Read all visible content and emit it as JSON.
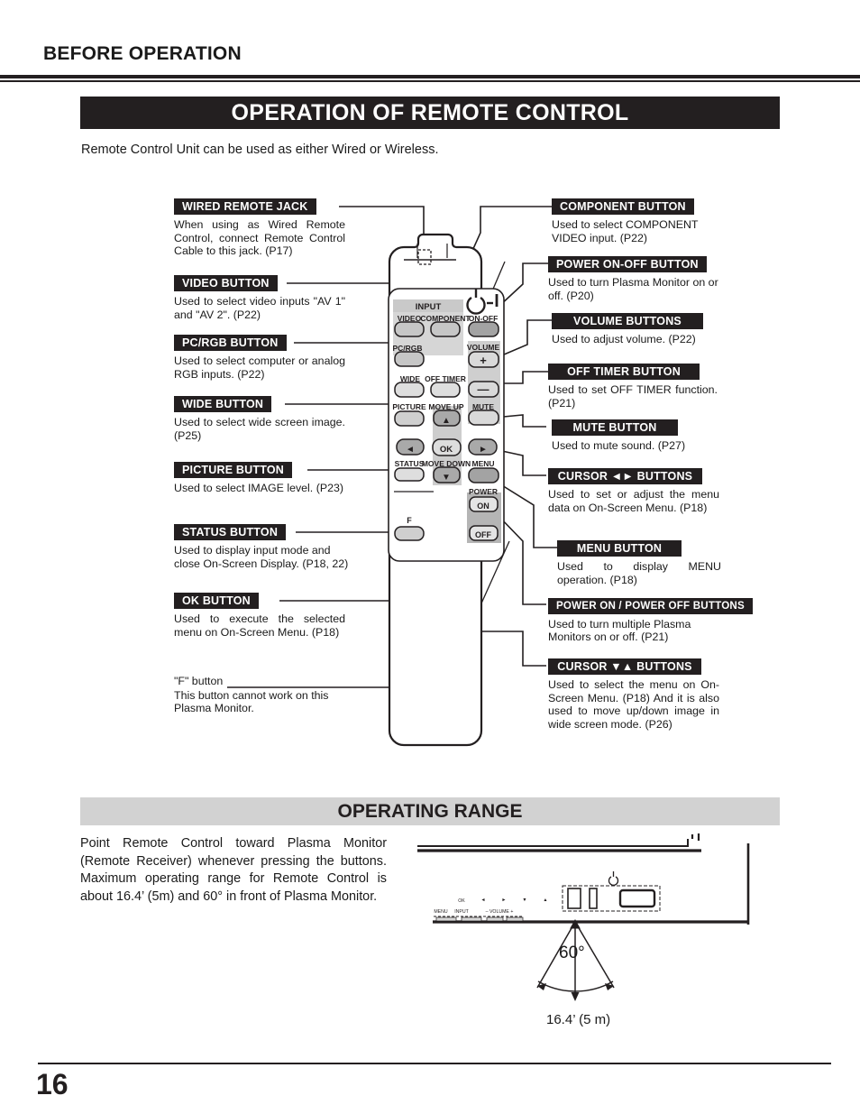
{
  "header": {
    "running_head": "BEFORE OPERATION",
    "section_title": "OPERATION OF REMOTE CONTROL",
    "intro": "Remote Control Unit can be used as either Wired or Wireless."
  },
  "callouts_left": [
    {
      "label": "WIRED REMOTE JACK",
      "desc": "When using as Wired Remote Control, connect Remote Control Cable to this jack.  (P17)"
    },
    {
      "label": "VIDEO BUTTON",
      "desc": "Used to select video inputs \"AV 1\" and \"AV 2\".  (P22)"
    },
    {
      "label": "PC/RGB BUTTON",
      "desc": "Used to select computer or analog RGB inputs.  (P22)"
    },
    {
      "label": "WIDE BUTTON",
      "desc": "Used to select wide screen image.  (P25)"
    },
    {
      "label": "PICTURE BUTTON",
      "desc": "Used to select IMAGE level. (P23)"
    },
    {
      "label": "STATUS BUTTON",
      "desc": "Used to display input mode and close On-Screen Display. (P18, 22)"
    },
    {
      "label": "OK BUTTON",
      "desc": "Used to execute the selected menu on On-Screen Menu. (P18)"
    }
  ],
  "f_note": {
    "title": "\"F\" button",
    "desc": "This button cannot work on this Plasma Monitor."
  },
  "callouts_right": [
    {
      "label": "COMPONENT BUTTON",
      "desc": "Used to select COMPONENT VIDEO input.  (P22)"
    },
    {
      "label": "POWER ON-OFF BUTTON",
      "desc": "Used to turn Plasma Monitor on or off.  (P20)"
    },
    {
      "label": "VOLUME BUTTONS",
      "desc": "Used to adjust volume.  (P22)"
    },
    {
      "label": "OFF TIMER BUTTON",
      "desc": "Used to set OFF TIMER function.  (P21)"
    },
    {
      "label": "MUTE BUTTON",
      "desc": "Used to mute sound. (P27)"
    },
    {
      "label": "CURSOR ◄► BUTTONS",
      "desc": "Used to set or adjust the menu data on On-Screen Menu. (P18)"
    },
    {
      "label": "MENU BUTTON",
      "desc": "Used to display MENU operation.  (P18)"
    },
    {
      "label": "POWER ON / POWER OFF BUTTONS",
      "desc": "Used to turn multiple Plasma Monitors on or off.  (P21)"
    },
    {
      "label": "CURSOR ▼▲ BUTTONS",
      "desc": "Used to select the menu on On-Screen Menu. (P18) And it is also used to move up/down image in wide screen mode.  (P26)"
    }
  ],
  "remote": {
    "input_group": "INPUT",
    "power_glyph": "⏻-|",
    "keys": {
      "video": "VIDEO",
      "component": "COMPONENT",
      "on_off": "ON-OFF",
      "pc_rgb": "PC/RGB",
      "volume": "VOLUME",
      "volume_plus": "+",
      "volume_minus": "—",
      "wide": "WIDE",
      "off_timer": "OFF TIMER",
      "mute": "MUTE",
      "picture": "PICTURE",
      "move_up": "MOVE UP",
      "up_arrow": "▲",
      "left_arrow": "◄",
      "ok": "OK",
      "right_arrow": "►",
      "status": "STATUS",
      "move_down": "MOVE DOWN",
      "down_arrow": "▼",
      "menu": "MENU",
      "power": "POWER",
      "power_on": "ON",
      "power_off": "OFF",
      "f": "F"
    }
  },
  "range": {
    "bar_title": "OPERATING RANGE",
    "paragraph": "Point Remote Control toward Plasma Monitor (Remote Receiver) whenever pressing the buttons.  Maximum operating range for Remote Control is about 16.4’ (5m) and 60° in front of Plasma Monitor.",
    "angle": "60°",
    "distance": "16.4’ (5 m)",
    "monitor_labels_top": [
      "OK",
      "◄",
      "►",
      "▼",
      "▲"
    ],
    "monitor_labels_bottom": [
      "MENU",
      "INPUT",
      "– VOLUME +"
    ],
    "power_glyph": "⏻"
  },
  "footer": {
    "page_number": "16"
  },
  "colors": {
    "ink": "#231f20",
    "chip_bg": "#231f20",
    "chip_fg": "#ffffff",
    "band_gray": "#d2d2d2",
    "remote_body": "#ffffff",
    "key_light": "#d8d8d8",
    "key_dark": "#a8a8a8",
    "panel_gray": "#cccccc"
  }
}
